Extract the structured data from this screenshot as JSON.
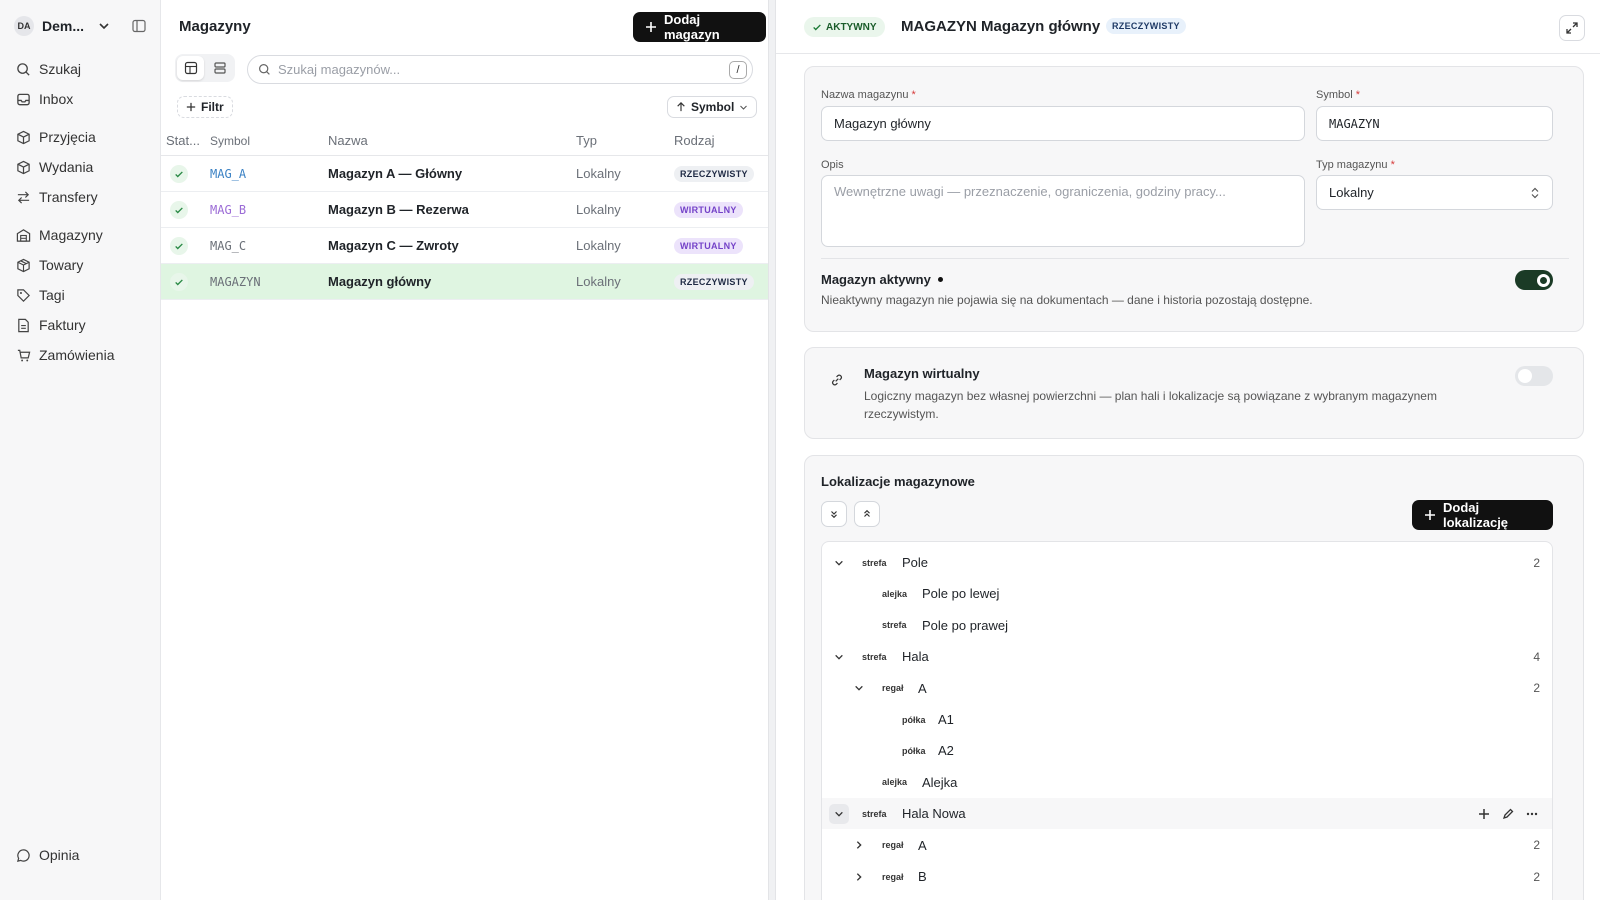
{
  "sidebar": {
    "workspace_initials": "DA",
    "workspace_name": "Dem...",
    "items": [
      {
        "label": "Szukaj",
        "icon": "search-icon"
      },
      {
        "label": "Inbox",
        "icon": "inbox-icon"
      },
      {
        "label": "Przyjęcia",
        "icon": "box-in-icon"
      },
      {
        "label": "Wydania",
        "icon": "box-out-icon"
      },
      {
        "label": "Transfery",
        "icon": "transfer-icon"
      },
      {
        "label": "Magazyny",
        "icon": "warehouse-icon"
      },
      {
        "label": "Towary",
        "icon": "package-icon"
      },
      {
        "label": "Tagi",
        "icon": "tag-icon"
      },
      {
        "label": "Faktury",
        "icon": "invoice-icon"
      },
      {
        "label": "Zamówienia",
        "icon": "cart-icon"
      }
    ],
    "footer_label": "Opinia"
  },
  "list": {
    "title": "Magazyny",
    "add_button": "Dodaj magazyn",
    "search_placeholder": "Szukaj magazynów...",
    "search_shortcut": "/",
    "filter_label": "Filtr",
    "sort_label": "Symbol",
    "columns": [
      "Stat...",
      "Symbol",
      "Nazwa",
      "Typ",
      "Rodzaj"
    ],
    "rows": [
      {
        "symbol": "MAG_A",
        "name": "Magazyn A — Główny",
        "type": "Lokalny",
        "kind": "RZECZYWISTY",
        "kind_class": "b-real",
        "symbol_color": "#3b82c4"
      },
      {
        "symbol": "MAG_B",
        "name": "Magazyn B — Rezerwa",
        "type": "Lokalny",
        "kind": "WIRTUALNY",
        "kind_class": "b-virt",
        "symbol_color": "#9b6bd6"
      },
      {
        "symbol": "MAG_C",
        "name": "Magazyn C — Zwroty",
        "type": "Lokalny",
        "kind": "WIRTUALNY",
        "kind_class": "b-virt",
        "symbol_color": "#6b7078"
      },
      {
        "symbol": "MAGAZYN",
        "name": "Magazyn główny",
        "type": "Lokalny",
        "kind": "RZECZYWISTY",
        "kind_class": "b-real",
        "symbol_color": "#6b7078"
      }
    ]
  },
  "detail": {
    "status_badge": "AKTYWNY",
    "title": "MAGAZYN Magazyn główny",
    "kind_badge": "RZECZYWISTY",
    "form": {
      "name_label": "Nazwa magazynu",
      "name_value": "Magazyn główny",
      "symbol_label": "Symbol",
      "symbol_value": "MAGAZYN",
      "desc_label": "Opis",
      "desc_placeholder": "Wewnętrzne uwagi — przeznaczenie, ograniczenia, godziny pracy...",
      "type_label": "Typ magazynu",
      "type_value": "Lokalny",
      "required_mark": "*",
      "active_title": "Magazyn aktywny",
      "active_desc": "Nieaktywny magazyn nie pojawia się na dokumentach — dane i historia pozostają dostępne.",
      "active_on": true
    },
    "virtual": {
      "title": "Magazyn wirtualny",
      "desc": "Logiczny magazyn bez własnej powierzchni — plan hali i lokalizacje są powiązane z wybranym magazynem rzeczywistym.",
      "on": false
    },
    "locations": {
      "title": "Lokalizacje magazynowe",
      "add_button": "Dodaj lokalizację",
      "nodes": [
        {
          "level": 0,
          "chevron": "down",
          "type": "strefa",
          "name": "Pole",
          "count": "2"
        },
        {
          "level": 1,
          "chevron": "none",
          "type": "alejka",
          "name": "Pole po lewej",
          "count": ""
        },
        {
          "level": 1,
          "chevron": "none",
          "type": "strefa",
          "name": "Pole po prawej",
          "count": ""
        },
        {
          "level": 0,
          "chevron": "down",
          "type": "strefa",
          "name": "Hala",
          "count": "4"
        },
        {
          "level": 1,
          "chevron": "down",
          "type": "regał",
          "name": "A",
          "count": "2"
        },
        {
          "level": 2,
          "chevron": "none",
          "type": "półka",
          "name": "A1",
          "count": ""
        },
        {
          "level": 2,
          "chevron": "none",
          "type": "półka",
          "name": "A2",
          "count": ""
        },
        {
          "level": 1,
          "chevron": "none",
          "type": "alejka",
          "name": "Alejka",
          "count": ""
        },
        {
          "level": 0,
          "chevron": "down-boxed",
          "type": "strefa",
          "name": "Hala Nowa",
          "count": "",
          "hover": true
        },
        {
          "level": 1,
          "chevron": "right",
          "type": "regał",
          "name": "A",
          "count": "2"
        },
        {
          "level": 1,
          "chevron": "right",
          "type": "regał",
          "name": "B",
          "count": "2"
        }
      ]
    }
  }
}
